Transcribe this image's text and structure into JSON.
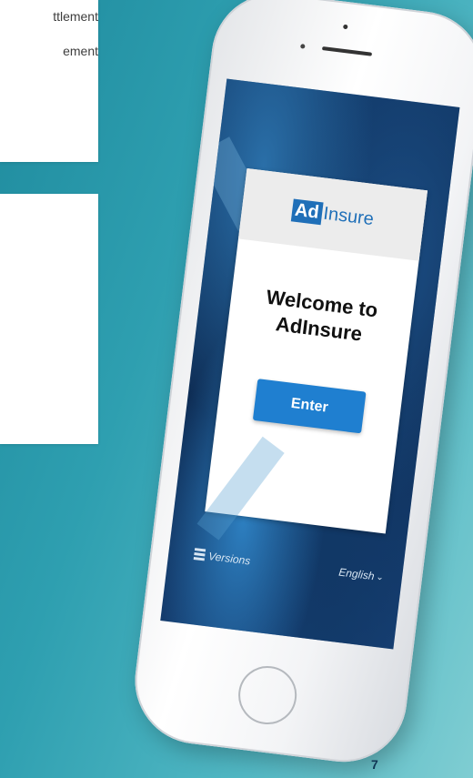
{
  "background_panels": {
    "top_lines": [
      "ttlement",
      "ement"
    ]
  },
  "app": {
    "logo": {
      "box": "Ad",
      "text": "Insure"
    },
    "welcome_text": "Welcome to AdInsure",
    "enter_label": "Enter",
    "footer": {
      "versions_label": "Versions",
      "versions_icon": "stack-icon",
      "language_label": "English",
      "language_icon": "chevron-down-icon"
    }
  },
  "page_number": "7",
  "colors": {
    "brand_blue": "#1f6fb8",
    "button_blue": "#1f7fd0",
    "background_teal": "#2e9fb0"
  }
}
